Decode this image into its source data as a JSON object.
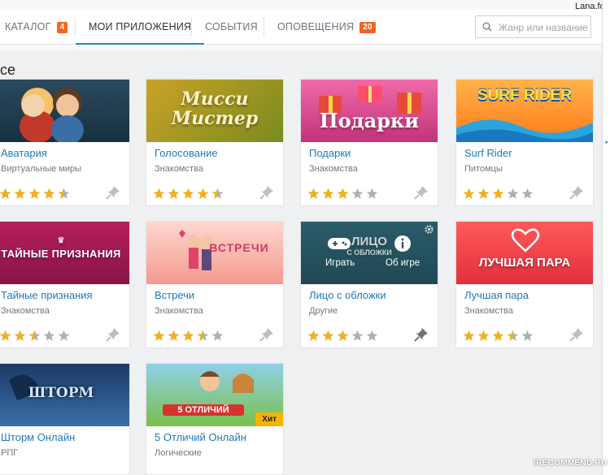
{
  "user": {
    "name": "Lana.foxy"
  },
  "nav": {
    "tabs": [
      {
        "label": "КАТАЛОГ",
        "badge": "4"
      },
      {
        "label": "МОИ ПРИЛОЖЕНИЯ"
      },
      {
        "label": "СОБЫТИЯ"
      },
      {
        "label": "ОПОВЕЩЕНИЯ",
        "badge": "20"
      }
    ],
    "active_tab": "МОИ ПРИЛОЖЕНИЯ"
  },
  "search": {
    "placeholder": "Жанр или название",
    "icon": "search-icon"
  },
  "section": {
    "title": "се"
  },
  "colors": {
    "accent": "#1e88c8",
    "badge": "#f26522",
    "star_on": "#f2b01e",
    "star_off": "#a9b1b8"
  },
  "apps": [
    {
      "name": "Аватария",
      "genre": "Виртуальные миры",
      "rating": 4.5
    },
    {
      "name": "Голосование",
      "genre": "Знакомства",
      "rating": 4.5,
      "thumb_title": "Мисси Мистер"
    },
    {
      "name": "Подарки",
      "genre": "Знакомства",
      "rating": 3,
      "thumb_title": "Подарки"
    },
    {
      "name": "Surf Rider",
      "genre": "Питомцы",
      "rating": 3,
      "thumb_title": "SURF RIDER"
    },
    {
      "name": "Тайные признания",
      "genre": "Знакомства",
      "rating": 2.5,
      "thumb_title": "ТАЙНЫЕ ПРИЗНАНИЯ"
    },
    {
      "name": "Встречи",
      "genre": "Знакомства",
      "rating": 3.5,
      "thumb_title": "ВСТРЕЧИ"
    },
    {
      "name": "Лицо с обложки",
      "genre": "Другие",
      "rating": 3,
      "thumb_title": "ЛИЦО",
      "thumb_subtitle": "С ОБЛОЖКИ",
      "play_label": "Играть",
      "about_label": "Об игре"
    },
    {
      "name": "Лучшая пара",
      "genre": "Знакомства",
      "rating": 3.5,
      "thumb_title": "ЛУЧШАЯ ПАРА"
    },
    {
      "name": "Шторм Онлайн",
      "genre": "РПГ",
      "thumb_title": "ШТОРМ"
    },
    {
      "name": "5 Отличий Онлайн",
      "genre": "Логические",
      "badge": "Хит",
      "thumb_title": "5 ОТЛИЧИЙ"
    }
  ],
  "watermark": "iRECOMMEND.RU"
}
